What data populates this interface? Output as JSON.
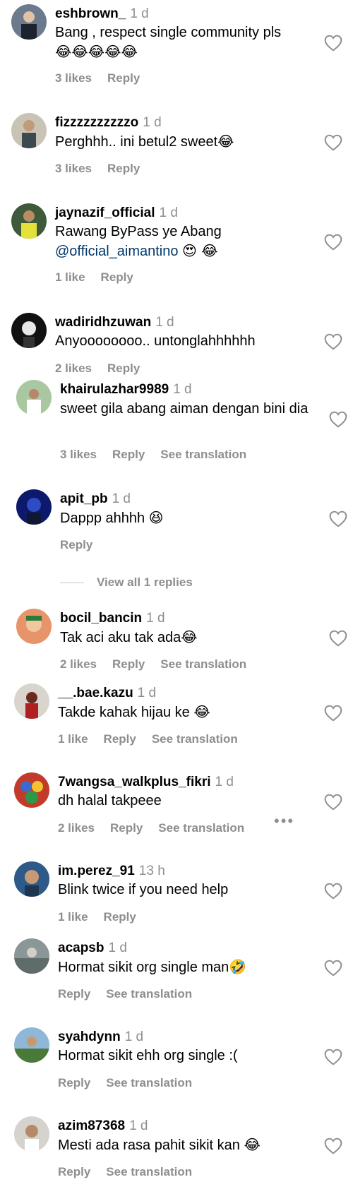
{
  "comments": [
    {
      "username": "eshbrown_",
      "time": "1 d",
      "text": "Bang , respect single community pls",
      "emoji": "😂😂😂😂😂",
      "likes": "3 likes",
      "reply": "Reply",
      "see_translation": ""
    },
    {
      "username": "fizzzzzzzzzzo",
      "time": "1 d",
      "text": "Perghhh.. ini betul2 sweet",
      "emoji": "😂",
      "likes": "3 likes",
      "reply": "Reply",
      "see_translation": ""
    },
    {
      "username": "jaynazif_official",
      "time": "1 d",
      "text": "Rawang ByPass ye Abang",
      "mention": "@official_aimantino",
      "emoji": "😍 😂",
      "likes": "1 like",
      "reply": "Reply",
      "see_translation": ""
    },
    {
      "username": "wadiridhzuwan",
      "time": "1 d",
      "text": "Anyoooooooo.. untonglahhhhhh",
      "emoji": "",
      "likes": "2 likes",
      "reply": "Reply",
      "see_translation": ""
    },
    {
      "username": "khairulazhar9989",
      "time": "1 d",
      "text": "sweet gila abang aiman dengan bini dia",
      "emoji": "",
      "likes": "3 likes",
      "reply": "Reply",
      "see_translation": "See translation"
    },
    {
      "username": "apit_pb",
      "time": "1 d",
      "text": "Dappp ahhhh",
      "emoji": "😆",
      "likes": "",
      "reply": "Reply",
      "see_translation": ""
    },
    {
      "username": "bocil_bancin",
      "time": "1 d",
      "text": "Tak aci aku tak ada",
      "emoji": "😂",
      "likes": "2 likes",
      "reply": "Reply",
      "see_translation": "See translation"
    },
    {
      "username": "__.bae.kazu",
      "time": "1 d",
      "text": "Takde kahak hijau ke",
      "emoji": "😂",
      "likes": "1 like",
      "reply": "Reply",
      "see_translation": "See translation"
    },
    {
      "username": "7wangsa_walkplus_fikri",
      "time": "1 d",
      "text": "dh halal takpeee",
      "emoji": "",
      "likes": "2 likes",
      "reply": "Reply",
      "see_translation": "See translation"
    },
    {
      "username": "im.perez_91",
      "time": "13 h",
      "text": "Blink twice if you need help",
      "emoji": "",
      "likes": "1 like",
      "reply": "Reply",
      "see_translation": ""
    },
    {
      "username": "acapsb",
      "time": "1 d",
      "text": "Hormat sikit org single man",
      "emoji": "🤣",
      "likes": "",
      "reply": "Reply",
      "see_translation": "See translation"
    },
    {
      "username": "syahdynn",
      "time": "1 d",
      "text": "Hormat sikit ehh org single :(",
      "emoji": "",
      "likes": "",
      "reply": "Reply",
      "see_translation": "See translation"
    },
    {
      "username": "azim87368",
      "time": "1 d",
      "text": "Mesti ada rasa pahit sikit kan",
      "emoji": "😂",
      "likes": "",
      "reply": "Reply",
      "see_translation": "See translation"
    }
  ],
  "view_replies": "View all 1 replies",
  "more_options": "•••",
  "colors": {
    "muted": "#8e8e8e",
    "mention": "#00376b",
    "heart_stroke": "#8e8e8e"
  }
}
